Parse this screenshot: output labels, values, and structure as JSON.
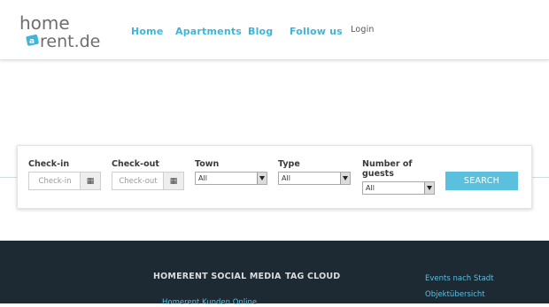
{
  "logo": {
    "text_top": "home",
    "text_bottom": "rent.de",
    "badge": "a"
  },
  "nav": {
    "items": [
      {
        "label": "Home"
      },
      {
        "label": "Apartments"
      },
      {
        "label": "Blog"
      },
      {
        "label": "Follow us"
      }
    ],
    "login": "Login"
  },
  "search": {
    "checkin": {
      "label": "Check-in",
      "placeholder": "Check-in"
    },
    "checkout": {
      "label": "Check-out",
      "placeholder": "Check-out"
    },
    "town": {
      "label": "Town",
      "value": "All"
    },
    "type": {
      "label": "Type",
      "value": "All"
    },
    "guests": {
      "label_line1": "Number of",
      "label_line2": "guests",
      "value": "All"
    },
    "button": "SEARCH"
  },
  "footer": {
    "social_title": "HOMERENT SOCIAL MEDIA",
    "tagcloud_title": "TAG CLOUD",
    "social_link": "Homerent Kunden Online",
    "links": [
      "Events nach Stadt",
      "Objektübersicht"
    ]
  },
  "colors": {
    "accent": "#5bc0de",
    "nav": "#3fb5d9",
    "footer_bg": "#1d2a33",
    "logo_gray": "#6e6e6e"
  }
}
